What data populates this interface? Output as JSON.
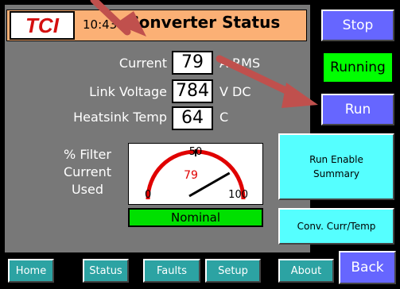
{
  "header": {
    "logo_text": "TCI",
    "time": "10:43",
    "title": "Converter Status"
  },
  "readings": [
    {
      "label": "Current",
      "value": "79",
      "unit": "A RMS"
    },
    {
      "label": "Link Voltage",
      "value": "784",
      "unit": "V DC"
    },
    {
      "label": "Heatsink Temp",
      "value": "64",
      "unit": "C"
    }
  ],
  "filter": {
    "label_lines": [
      "% Filter",
      "Current",
      "Used"
    ],
    "gauge": {
      "min_label": "0",
      "mid_label": "50",
      "max_label": "100",
      "value": 79,
      "value_text": "79",
      "min": 0,
      "max": 100,
      "status": "Nominal",
      "status_color": "#00e000",
      "arc_color": "#e00000"
    }
  },
  "controls": {
    "stop": "Stop",
    "running": "Running",
    "run": "Run",
    "run_enable_summary": [
      "Run Enable",
      "Summary"
    ],
    "conv_curr_temp": "Conv. Curr/Temp",
    "back": "Back"
  },
  "nav": [
    {
      "label": "Home"
    },
    {
      "label": "Status"
    },
    {
      "label": "Faults"
    },
    {
      "label": "Setup"
    },
    {
      "label": "About"
    }
  ],
  "colors": {
    "header_bg": "#fbb075",
    "panel_bg": "#787878",
    "button_blue": "#6666ff",
    "button_cyan": "#55ffff",
    "button_nav": "#2ca3a3",
    "running_green": "#00ff00",
    "arrow_red": "#c0504d"
  },
  "icons": [
    "annotation-arrow-icon",
    "gauge-needle-icon"
  ]
}
